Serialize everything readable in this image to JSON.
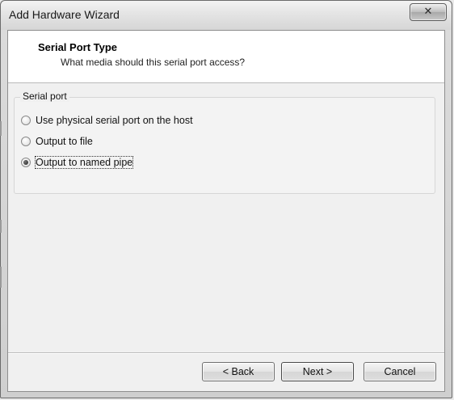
{
  "window": {
    "title": "Add Hardware Wizard",
    "close_symbol": "✕"
  },
  "header": {
    "title": "Serial Port Type",
    "subtitle": "What media should this serial port access?"
  },
  "serial_port_group": {
    "label": "Serial port",
    "options": [
      {
        "label": "Use physical serial port on the host",
        "checked": false
      },
      {
        "label": "Output to file",
        "checked": false
      },
      {
        "label": "Output to named pipe",
        "checked": true
      }
    ]
  },
  "footer": {
    "back_label": "< Back",
    "next_label": "Next >",
    "cancel_label": "Cancel"
  }
}
